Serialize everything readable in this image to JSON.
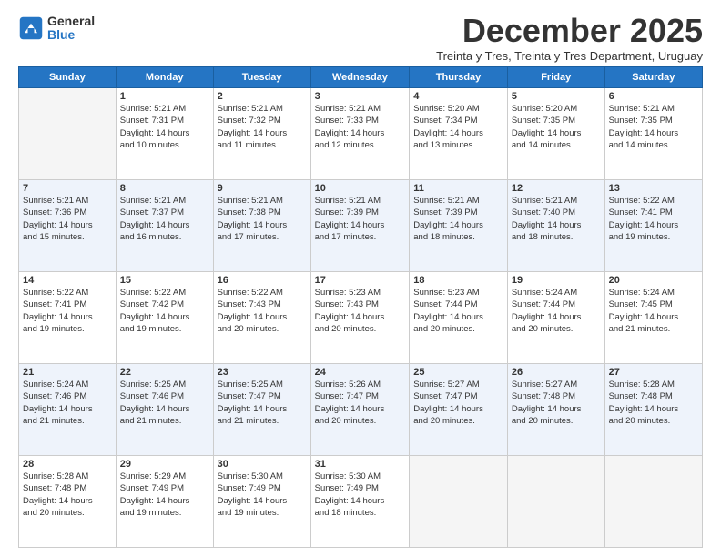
{
  "logo": {
    "general": "General",
    "blue": "Blue"
  },
  "title": "December 2025",
  "subtitle": "Treinta y Tres, Treinta y Tres Department, Uruguay",
  "days": [
    "Sunday",
    "Monday",
    "Tuesday",
    "Wednesday",
    "Thursday",
    "Friday",
    "Saturday"
  ],
  "weeks": [
    [
      {
        "day": "",
        "info": ""
      },
      {
        "day": "1",
        "info": "Sunrise: 5:21 AM\nSunset: 7:31 PM\nDaylight: 14 hours\nand 10 minutes."
      },
      {
        "day": "2",
        "info": "Sunrise: 5:21 AM\nSunset: 7:32 PM\nDaylight: 14 hours\nand 11 minutes."
      },
      {
        "day": "3",
        "info": "Sunrise: 5:21 AM\nSunset: 7:33 PM\nDaylight: 14 hours\nand 12 minutes."
      },
      {
        "day": "4",
        "info": "Sunrise: 5:20 AM\nSunset: 7:34 PM\nDaylight: 14 hours\nand 13 minutes."
      },
      {
        "day": "5",
        "info": "Sunrise: 5:20 AM\nSunset: 7:35 PM\nDaylight: 14 hours\nand 14 minutes."
      },
      {
        "day": "6",
        "info": "Sunrise: 5:21 AM\nSunset: 7:35 PM\nDaylight: 14 hours\nand 14 minutes."
      }
    ],
    [
      {
        "day": "7",
        "info": "Sunrise: 5:21 AM\nSunset: 7:36 PM\nDaylight: 14 hours\nand 15 minutes."
      },
      {
        "day": "8",
        "info": "Sunrise: 5:21 AM\nSunset: 7:37 PM\nDaylight: 14 hours\nand 16 minutes."
      },
      {
        "day": "9",
        "info": "Sunrise: 5:21 AM\nSunset: 7:38 PM\nDaylight: 14 hours\nand 17 minutes."
      },
      {
        "day": "10",
        "info": "Sunrise: 5:21 AM\nSunset: 7:39 PM\nDaylight: 14 hours\nand 17 minutes."
      },
      {
        "day": "11",
        "info": "Sunrise: 5:21 AM\nSunset: 7:39 PM\nDaylight: 14 hours\nand 18 minutes."
      },
      {
        "day": "12",
        "info": "Sunrise: 5:21 AM\nSunset: 7:40 PM\nDaylight: 14 hours\nand 18 minutes."
      },
      {
        "day": "13",
        "info": "Sunrise: 5:22 AM\nSunset: 7:41 PM\nDaylight: 14 hours\nand 19 minutes."
      }
    ],
    [
      {
        "day": "14",
        "info": "Sunrise: 5:22 AM\nSunset: 7:41 PM\nDaylight: 14 hours\nand 19 minutes."
      },
      {
        "day": "15",
        "info": "Sunrise: 5:22 AM\nSunset: 7:42 PM\nDaylight: 14 hours\nand 19 minutes."
      },
      {
        "day": "16",
        "info": "Sunrise: 5:22 AM\nSunset: 7:43 PM\nDaylight: 14 hours\nand 20 minutes."
      },
      {
        "day": "17",
        "info": "Sunrise: 5:23 AM\nSunset: 7:43 PM\nDaylight: 14 hours\nand 20 minutes."
      },
      {
        "day": "18",
        "info": "Sunrise: 5:23 AM\nSunset: 7:44 PM\nDaylight: 14 hours\nand 20 minutes."
      },
      {
        "day": "19",
        "info": "Sunrise: 5:24 AM\nSunset: 7:44 PM\nDaylight: 14 hours\nand 20 minutes."
      },
      {
        "day": "20",
        "info": "Sunrise: 5:24 AM\nSunset: 7:45 PM\nDaylight: 14 hours\nand 21 minutes."
      }
    ],
    [
      {
        "day": "21",
        "info": "Sunrise: 5:24 AM\nSunset: 7:46 PM\nDaylight: 14 hours\nand 21 minutes."
      },
      {
        "day": "22",
        "info": "Sunrise: 5:25 AM\nSunset: 7:46 PM\nDaylight: 14 hours\nand 21 minutes."
      },
      {
        "day": "23",
        "info": "Sunrise: 5:25 AM\nSunset: 7:47 PM\nDaylight: 14 hours\nand 21 minutes."
      },
      {
        "day": "24",
        "info": "Sunrise: 5:26 AM\nSunset: 7:47 PM\nDaylight: 14 hours\nand 20 minutes."
      },
      {
        "day": "25",
        "info": "Sunrise: 5:27 AM\nSunset: 7:47 PM\nDaylight: 14 hours\nand 20 minutes."
      },
      {
        "day": "26",
        "info": "Sunrise: 5:27 AM\nSunset: 7:48 PM\nDaylight: 14 hours\nand 20 minutes."
      },
      {
        "day": "27",
        "info": "Sunrise: 5:28 AM\nSunset: 7:48 PM\nDaylight: 14 hours\nand 20 minutes."
      }
    ],
    [
      {
        "day": "28",
        "info": "Sunrise: 5:28 AM\nSunset: 7:48 PM\nDaylight: 14 hours\nand 20 minutes."
      },
      {
        "day": "29",
        "info": "Sunrise: 5:29 AM\nSunset: 7:49 PM\nDaylight: 14 hours\nand 19 minutes."
      },
      {
        "day": "30",
        "info": "Sunrise: 5:30 AM\nSunset: 7:49 PM\nDaylight: 14 hours\nand 19 minutes."
      },
      {
        "day": "31",
        "info": "Sunrise: 5:30 AM\nSunset: 7:49 PM\nDaylight: 14 hours\nand 18 minutes."
      },
      {
        "day": "",
        "info": ""
      },
      {
        "day": "",
        "info": ""
      },
      {
        "day": "",
        "info": ""
      }
    ]
  ]
}
